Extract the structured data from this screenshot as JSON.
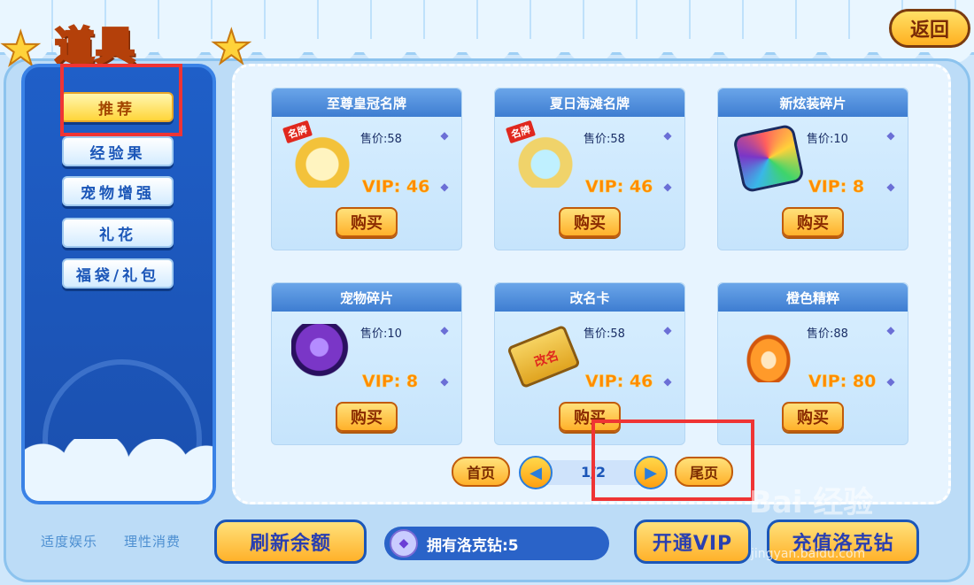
{
  "header": {
    "title": "道具",
    "back_label": "返回"
  },
  "sidebar": {
    "items": [
      {
        "label": "推荐",
        "active": true
      },
      {
        "label": "经验果",
        "active": false
      },
      {
        "label": "宠物增强",
        "active": false
      },
      {
        "label": "礼花",
        "active": false
      },
      {
        "label": "福袋/礼包",
        "active": false
      }
    ]
  },
  "items": [
    {
      "name": "至尊皇冠名牌",
      "price": "售价:58",
      "vip": "VIP: 46",
      "buy": "购买",
      "tag": "名牌",
      "icon": "crown-nameplate-icon",
      "color": "#f3c23a"
    },
    {
      "name": "夏日海滩名牌",
      "price": "售价:58",
      "vip": "VIP: 46",
      "buy": "购买",
      "tag": "名牌",
      "icon": "beach-nameplate-icon",
      "color": "#f0d36a"
    },
    {
      "name": "新炫装碎片",
      "price": "售价:10",
      "vip": "VIP: 8",
      "buy": "购买",
      "icon": "outfit-shard-icon",
      "color": "#39b7e8"
    },
    {
      "name": "宠物碎片",
      "price": "售价:10",
      "vip": "VIP: 8",
      "buy": "购买",
      "icon": "pet-shard-icon",
      "color": "#7a36c7"
    },
    {
      "name": "改名卡",
      "price": "售价:58",
      "vip": "VIP: 46",
      "buy": "购买",
      "tag": "改名",
      "icon": "rename-card-icon",
      "color": "#e8b53a"
    },
    {
      "name": "橙色精粹",
      "price": "售价:88",
      "vip": "VIP: 80",
      "buy": "购买",
      "icon": "orange-essence-icon",
      "color": "#ff9a2a"
    }
  ],
  "pagination": {
    "first": "首页",
    "last": "尾页",
    "page": "1/2"
  },
  "footer": {
    "slogan1": "适度娱乐",
    "slogan2": "理性消费",
    "refresh": "刷新余额",
    "balance": "拥有洛克钻:5",
    "vip": "开通VIP",
    "recharge": "充值洛克钻"
  },
  "watermark": {
    "main": "Bai 经验",
    "sub": "jingyan.baidu.com"
  },
  "colors": {
    "accent": "#ffb12a",
    "highlight": "#ef3434",
    "sidebar": "#1f5fc8"
  }
}
